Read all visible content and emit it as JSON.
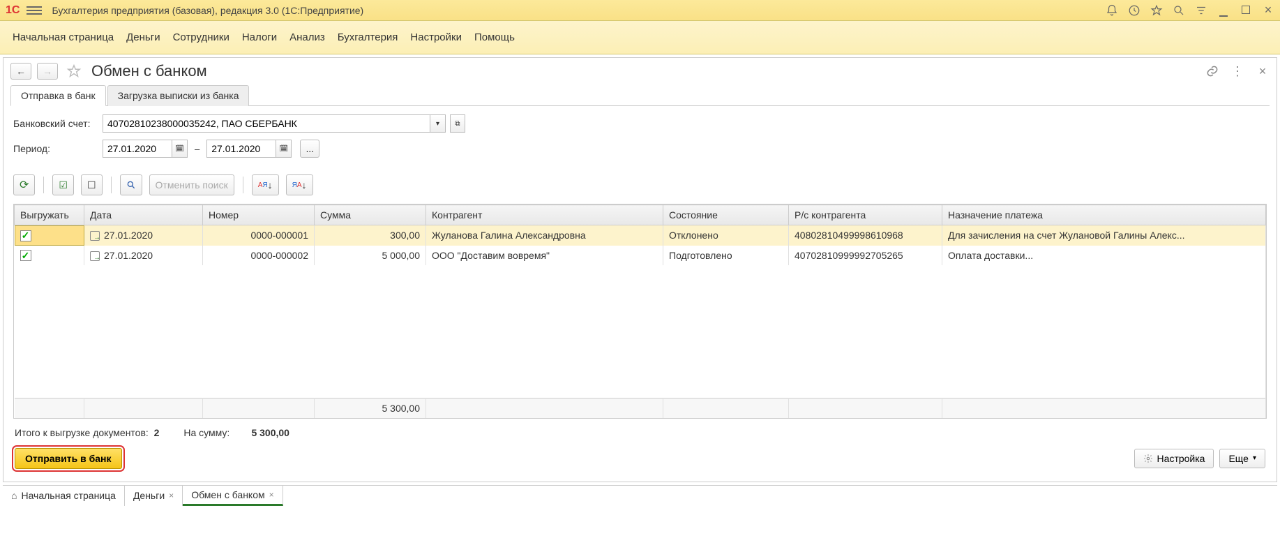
{
  "app": {
    "title": "Бухгалтерия предприятия (базовая), редакция 3.0  (1С:Предприятие)"
  },
  "menu": [
    "Начальная страница",
    "Деньги",
    "Сотрудники",
    "Налоги",
    "Анализ",
    "Бухгалтерия",
    "Настройки",
    "Помощь"
  ],
  "page": {
    "title": "Обмен с банком"
  },
  "tabs": {
    "send": "Отправка в банк",
    "load": "Загрузка выписки из банка"
  },
  "form": {
    "bank_label": "Банковский счет:",
    "bank_value": "40702810238000035242, ПАО СБЕРБАНК",
    "period_label": "Период:",
    "date_from": "27.01.2020",
    "date_to": "27.01.2020"
  },
  "toolbar": {
    "cancel_search": "Отменить поиск"
  },
  "table": {
    "headers": {
      "export": "Выгружать",
      "date": "Дата",
      "number": "Номер",
      "sum": "Сумма",
      "counterparty": "Контрагент",
      "status": "Состояние",
      "cp_account": "Р/с контрагента",
      "purpose": "Назначение платежа"
    },
    "rows": [
      {
        "checked": true,
        "date": "27.01.2020",
        "number": "0000-000001",
        "sum": "300,00",
        "counterparty": "Жуланова Галина Александровна",
        "status": "Отклонено",
        "cp_account": "40802810499998610968",
        "purpose": "Для зачисления на счет Жулановой Галины Алекс..."
      },
      {
        "checked": true,
        "date": "27.01.2020",
        "number": "0000-000002",
        "sum": "5 000,00",
        "counterparty": "ООО \"Доставим вовремя\"",
        "status": "Подготовлено",
        "cp_account": "40702810999992705265",
        "purpose": "Оплата доставки..."
      }
    ],
    "total_sum": "5 300,00"
  },
  "summary": {
    "docs_label": "Итого к выгрузке документов:",
    "docs_count": "2",
    "sum_label": "На сумму:",
    "sum_value": "5 300,00"
  },
  "buttons": {
    "send": "Отправить в банк",
    "settings": "Настройка",
    "more": "Еще"
  },
  "bottom_tabs": {
    "home": "Начальная страница",
    "money": "Деньги",
    "bank": "Обмен с банком"
  }
}
